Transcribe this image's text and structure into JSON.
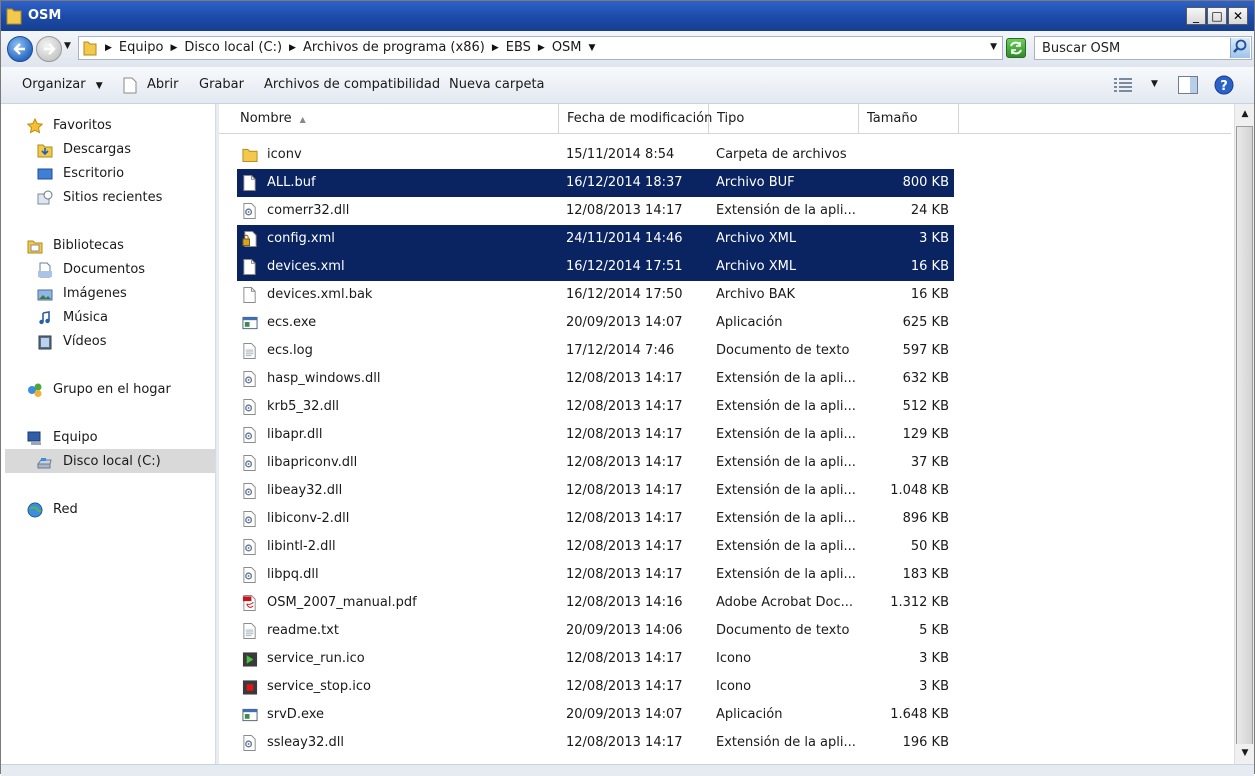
{
  "window": {
    "title": "OSM",
    "min": "_",
    "max": "□",
    "close": "✕"
  },
  "address": {
    "crumbs": [
      "Equipo",
      "Disco local (C:)",
      "Archivos de programa (x86)",
      "EBS",
      "OSM"
    ],
    "search_placeholder": "Buscar OSM"
  },
  "toolbar": {
    "organize": "Organizar",
    "open": "Abrir",
    "burn": "Grabar",
    "compat": "Archivos de compatibilidad",
    "new_folder": "Nueva carpeta"
  },
  "nav": {
    "favorites": "Favoritos",
    "downloads": "Descargas",
    "desktop": "Escritorio",
    "recent": "Sitios recientes",
    "libraries": "Bibliotecas",
    "documents": "Documentos",
    "images": "Imágenes",
    "music": "Música",
    "videos": "Vídeos",
    "homegroup": "Grupo en el hogar",
    "computer": "Equipo",
    "local_disk": "Disco local (C:)",
    "network": "Red"
  },
  "columns": {
    "name": "Nombre",
    "date": "Fecha de modificación",
    "type": "Tipo",
    "size": "Tamaño"
  },
  "files": [
    {
      "name": "iconv",
      "date": "15/11/2014 8:54",
      "type": "Carpeta de archivos",
      "size": "",
      "icon": "folder",
      "selected": false
    },
    {
      "name": "ALL.buf",
      "date": "16/12/2014 18:37",
      "type": "Archivo BUF",
      "size": "800 KB",
      "icon": "blank",
      "selected": true
    },
    {
      "name": "comerr32.dll",
      "date": "12/08/2013 14:17",
      "type": "Extensión de la apli...",
      "size": "24 KB",
      "icon": "dll",
      "selected": false
    },
    {
      "name": "config.xml",
      "date": "24/11/2014 14:46",
      "type": "Archivo XML",
      "size": "3 KB",
      "icon": "xml-lock",
      "selected": true
    },
    {
      "name": "devices.xml",
      "date": "16/12/2014 17:51",
      "type": "Archivo XML",
      "size": "16 KB",
      "icon": "blank",
      "selected": true
    },
    {
      "name": "devices.xml.bak",
      "date": "16/12/2014 17:50",
      "type": "Archivo BAK",
      "size": "16 KB",
      "icon": "blank",
      "selected": false
    },
    {
      "name": "ecs.exe",
      "date": "20/09/2013 14:07",
      "type": "Aplicación",
      "size": "625 KB",
      "icon": "exe",
      "selected": false
    },
    {
      "name": "ecs.log",
      "date": "17/12/2014 7:46",
      "type": "Documento de texto",
      "size": "597 KB",
      "icon": "text",
      "selected": false
    },
    {
      "name": "hasp_windows.dll",
      "date": "12/08/2013 14:17",
      "type": "Extensión de la apli...",
      "size": "632 KB",
      "icon": "dll",
      "selected": false
    },
    {
      "name": "krb5_32.dll",
      "date": "12/08/2013 14:17",
      "type": "Extensión de la apli...",
      "size": "512 KB",
      "icon": "dll",
      "selected": false
    },
    {
      "name": "libapr.dll",
      "date": "12/08/2013 14:17",
      "type": "Extensión de la apli...",
      "size": "129 KB",
      "icon": "dll",
      "selected": false
    },
    {
      "name": "libapriconv.dll",
      "date": "12/08/2013 14:17",
      "type": "Extensión de la apli...",
      "size": "37 KB",
      "icon": "dll",
      "selected": false
    },
    {
      "name": "libeay32.dll",
      "date": "12/08/2013 14:17",
      "type": "Extensión de la apli...",
      "size": "1.048 KB",
      "icon": "dll",
      "selected": false
    },
    {
      "name": "libiconv-2.dll",
      "date": "12/08/2013 14:17",
      "type": "Extensión de la apli...",
      "size": "896 KB",
      "icon": "dll",
      "selected": false
    },
    {
      "name": "libintl-2.dll",
      "date": "12/08/2013 14:17",
      "type": "Extensión de la apli...",
      "size": "50 KB",
      "icon": "dll",
      "selected": false
    },
    {
      "name": "libpq.dll",
      "date": "12/08/2013 14:17",
      "type": "Extensión de la apli...",
      "size": "183 KB",
      "icon": "dll",
      "selected": false
    },
    {
      "name": "OSM_2007_manual.pdf",
      "date": "12/08/2013 14:16",
      "type": "Adobe Acrobat Doc...",
      "size": "1.312 KB",
      "icon": "pdf",
      "selected": false
    },
    {
      "name": "readme.txt",
      "date": "20/09/2013 14:06",
      "type": "Documento de texto",
      "size": "5 KB",
      "icon": "text",
      "selected": false
    },
    {
      "name": "service_run.ico",
      "date": "12/08/2013 14:17",
      "type": "Icono",
      "size": "3 KB",
      "icon": "run",
      "selected": false
    },
    {
      "name": "service_stop.ico",
      "date": "12/08/2013 14:17",
      "type": "Icono",
      "size": "3 KB",
      "icon": "stop",
      "selected": false
    },
    {
      "name": "srvD.exe",
      "date": "20/09/2013 14:07",
      "type": "Aplicación",
      "size": "1.648 KB",
      "icon": "exe",
      "selected": false
    },
    {
      "name": "ssleay32.dll",
      "date": "12/08/2013 14:17",
      "type": "Extensión de la apli...",
      "size": "196 KB",
      "icon": "dll",
      "selected": false
    }
  ],
  "colors": {
    "selection": "#0a2462",
    "titlebar": "#1b4aa8"
  }
}
